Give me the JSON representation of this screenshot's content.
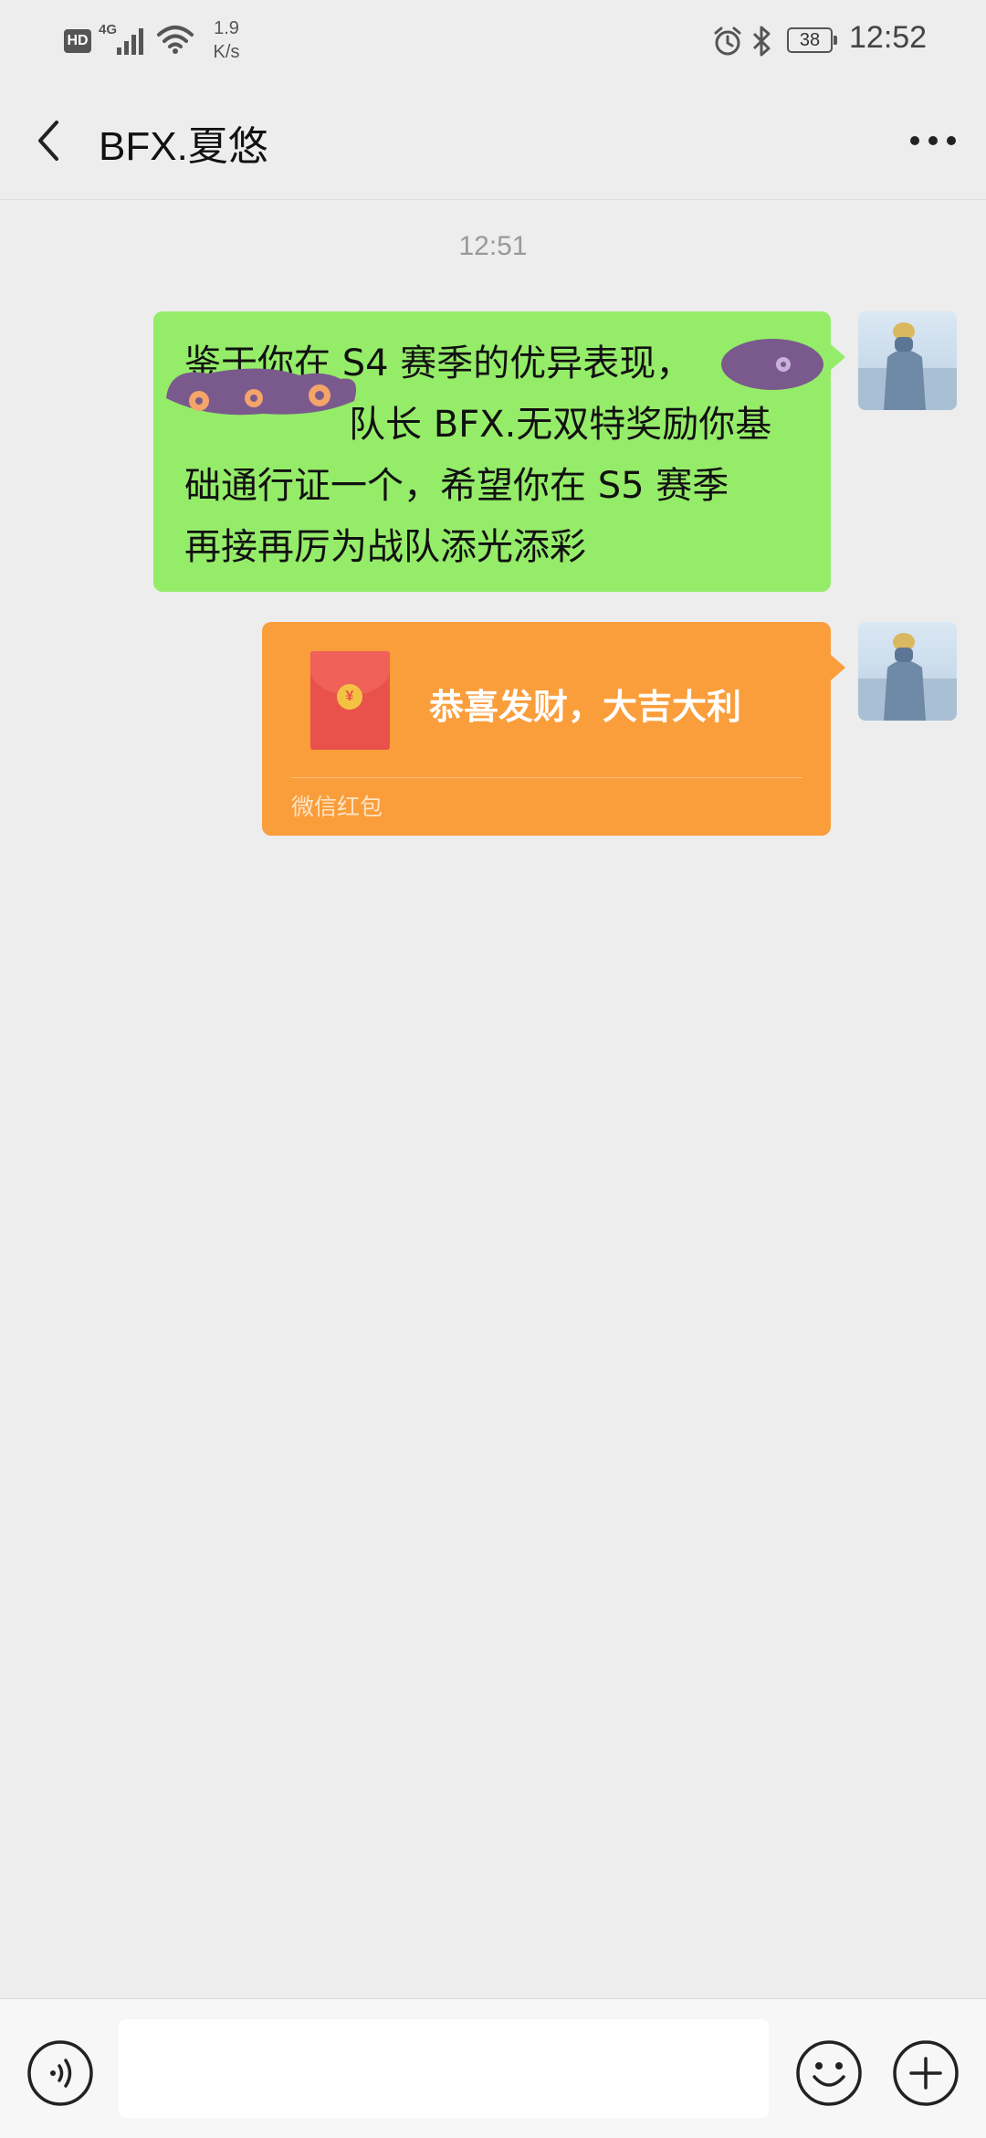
{
  "status_bar": {
    "hd_label": "HD",
    "network_label": "4G",
    "net_speed_value": "1.9",
    "net_speed_unit": "K/s",
    "battery_level": "38",
    "time": "12:52",
    "icons": [
      "signal-icon",
      "wifi-icon",
      "alarm-icon",
      "bluetooth-icon",
      "battery-icon"
    ]
  },
  "nav": {
    "back_icon": "chevron-left-icon",
    "title": "BFX.夏悠",
    "more_icon": "more-dots-icon"
  },
  "chat": {
    "timestamp": "12:51",
    "messages": [
      {
        "type": "text",
        "sender": "self",
        "lines": [
          "鉴于你在 S4 赛季的优异表现，",
          "队长 BFX.无双特奖励你基",
          "础通行证一个，希望你在 S5 赛季",
          "再接再厉为战队添光添彩"
        ]
      },
      {
        "type": "red_packet",
        "sender": "self",
        "greeting": "恭喜发财，大吉大利",
        "source_label": "微信红包"
      }
    ]
  },
  "input_bar": {
    "voice_icon": "voice-icon",
    "message_value": "",
    "emoji_icon": "emoji-icon",
    "plus_icon": "plus-icon"
  },
  "colors": {
    "background": "#ededed",
    "self_bubble": "#95ec69",
    "red_packet": "#fa9d3b",
    "envelope": "#e9524a"
  }
}
